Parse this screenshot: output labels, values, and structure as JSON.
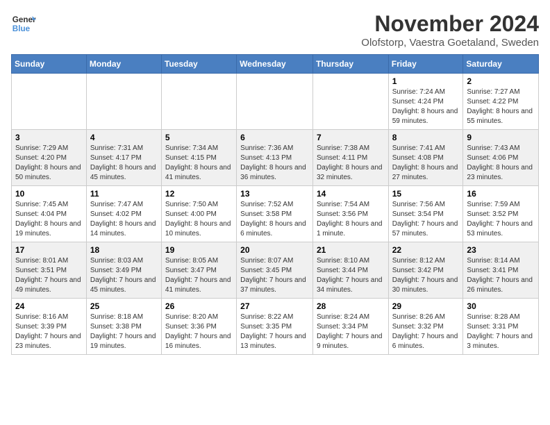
{
  "header": {
    "logo_line1": "General",
    "logo_line2": "Blue",
    "month_title": "November 2024",
    "subtitle": "Olofstorp, Vaestra Goetaland, Sweden"
  },
  "weekdays": [
    "Sunday",
    "Monday",
    "Tuesday",
    "Wednesday",
    "Thursday",
    "Friday",
    "Saturday"
  ],
  "weeks": [
    [
      {
        "day": "",
        "info": ""
      },
      {
        "day": "",
        "info": ""
      },
      {
        "day": "",
        "info": ""
      },
      {
        "day": "",
        "info": ""
      },
      {
        "day": "",
        "info": ""
      },
      {
        "day": "1",
        "info": "Sunrise: 7:24 AM\nSunset: 4:24 PM\nDaylight: 8 hours and 59 minutes."
      },
      {
        "day": "2",
        "info": "Sunrise: 7:27 AM\nSunset: 4:22 PM\nDaylight: 8 hours and 55 minutes."
      }
    ],
    [
      {
        "day": "3",
        "info": "Sunrise: 7:29 AM\nSunset: 4:20 PM\nDaylight: 8 hours and 50 minutes."
      },
      {
        "day": "4",
        "info": "Sunrise: 7:31 AM\nSunset: 4:17 PM\nDaylight: 8 hours and 45 minutes."
      },
      {
        "day": "5",
        "info": "Sunrise: 7:34 AM\nSunset: 4:15 PM\nDaylight: 8 hours and 41 minutes."
      },
      {
        "day": "6",
        "info": "Sunrise: 7:36 AM\nSunset: 4:13 PM\nDaylight: 8 hours and 36 minutes."
      },
      {
        "day": "7",
        "info": "Sunrise: 7:38 AM\nSunset: 4:11 PM\nDaylight: 8 hours and 32 minutes."
      },
      {
        "day": "8",
        "info": "Sunrise: 7:41 AM\nSunset: 4:08 PM\nDaylight: 8 hours and 27 minutes."
      },
      {
        "day": "9",
        "info": "Sunrise: 7:43 AM\nSunset: 4:06 PM\nDaylight: 8 hours and 23 minutes."
      }
    ],
    [
      {
        "day": "10",
        "info": "Sunrise: 7:45 AM\nSunset: 4:04 PM\nDaylight: 8 hours and 19 minutes."
      },
      {
        "day": "11",
        "info": "Sunrise: 7:47 AM\nSunset: 4:02 PM\nDaylight: 8 hours and 14 minutes."
      },
      {
        "day": "12",
        "info": "Sunrise: 7:50 AM\nSunset: 4:00 PM\nDaylight: 8 hours and 10 minutes."
      },
      {
        "day": "13",
        "info": "Sunrise: 7:52 AM\nSunset: 3:58 PM\nDaylight: 8 hours and 6 minutes."
      },
      {
        "day": "14",
        "info": "Sunrise: 7:54 AM\nSunset: 3:56 PM\nDaylight: 8 hours and 1 minute."
      },
      {
        "day": "15",
        "info": "Sunrise: 7:56 AM\nSunset: 3:54 PM\nDaylight: 7 hours and 57 minutes."
      },
      {
        "day": "16",
        "info": "Sunrise: 7:59 AM\nSunset: 3:52 PM\nDaylight: 7 hours and 53 minutes."
      }
    ],
    [
      {
        "day": "17",
        "info": "Sunrise: 8:01 AM\nSunset: 3:51 PM\nDaylight: 7 hours and 49 minutes."
      },
      {
        "day": "18",
        "info": "Sunrise: 8:03 AM\nSunset: 3:49 PM\nDaylight: 7 hours and 45 minutes."
      },
      {
        "day": "19",
        "info": "Sunrise: 8:05 AM\nSunset: 3:47 PM\nDaylight: 7 hours and 41 minutes."
      },
      {
        "day": "20",
        "info": "Sunrise: 8:07 AM\nSunset: 3:45 PM\nDaylight: 7 hours and 37 minutes."
      },
      {
        "day": "21",
        "info": "Sunrise: 8:10 AM\nSunset: 3:44 PM\nDaylight: 7 hours and 34 minutes."
      },
      {
        "day": "22",
        "info": "Sunrise: 8:12 AM\nSunset: 3:42 PM\nDaylight: 7 hours and 30 minutes."
      },
      {
        "day": "23",
        "info": "Sunrise: 8:14 AM\nSunset: 3:41 PM\nDaylight: 7 hours and 26 minutes."
      }
    ],
    [
      {
        "day": "24",
        "info": "Sunrise: 8:16 AM\nSunset: 3:39 PM\nDaylight: 7 hours and 23 minutes."
      },
      {
        "day": "25",
        "info": "Sunrise: 8:18 AM\nSunset: 3:38 PM\nDaylight: 7 hours and 19 minutes."
      },
      {
        "day": "26",
        "info": "Sunrise: 8:20 AM\nSunset: 3:36 PM\nDaylight: 7 hours and 16 minutes."
      },
      {
        "day": "27",
        "info": "Sunrise: 8:22 AM\nSunset: 3:35 PM\nDaylight: 7 hours and 13 minutes."
      },
      {
        "day": "28",
        "info": "Sunrise: 8:24 AM\nSunset: 3:34 PM\nDaylight: 7 hours and 9 minutes."
      },
      {
        "day": "29",
        "info": "Sunrise: 8:26 AM\nSunset: 3:32 PM\nDaylight: 7 hours and 6 minutes."
      },
      {
        "day": "30",
        "info": "Sunrise: 8:28 AM\nSunset: 3:31 PM\nDaylight: 7 hours and 3 minutes."
      }
    ]
  ]
}
